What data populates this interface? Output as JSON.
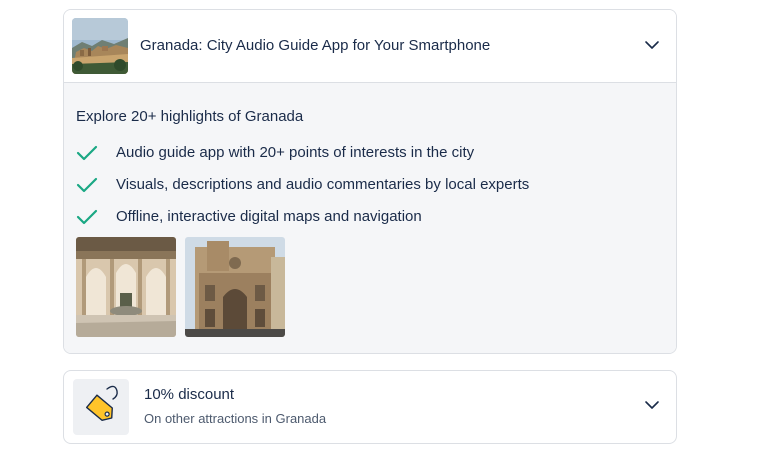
{
  "product": {
    "title": "Granada: City Audio Guide App for Your Smartphone",
    "intro": "Explore 20+ highlights of Granada",
    "features": [
      "Audio guide app with 20+ points of interests in the city",
      "Visuals, descriptions and audio commentaries by local experts",
      "Offline, interactive digital maps and navigation"
    ],
    "expand_icon": "chevron-down-icon"
  },
  "discount": {
    "title": "10% discount",
    "subtitle": "On other attractions in Granada",
    "icon": "price-tag-icon",
    "expand_icon": "chevron-down-icon"
  },
  "colors": {
    "check": "#1aa884",
    "tag": "#ffc42a",
    "text": "#1a2b49",
    "panel": "#f5f6f8",
    "border": "#dcdfe4"
  }
}
